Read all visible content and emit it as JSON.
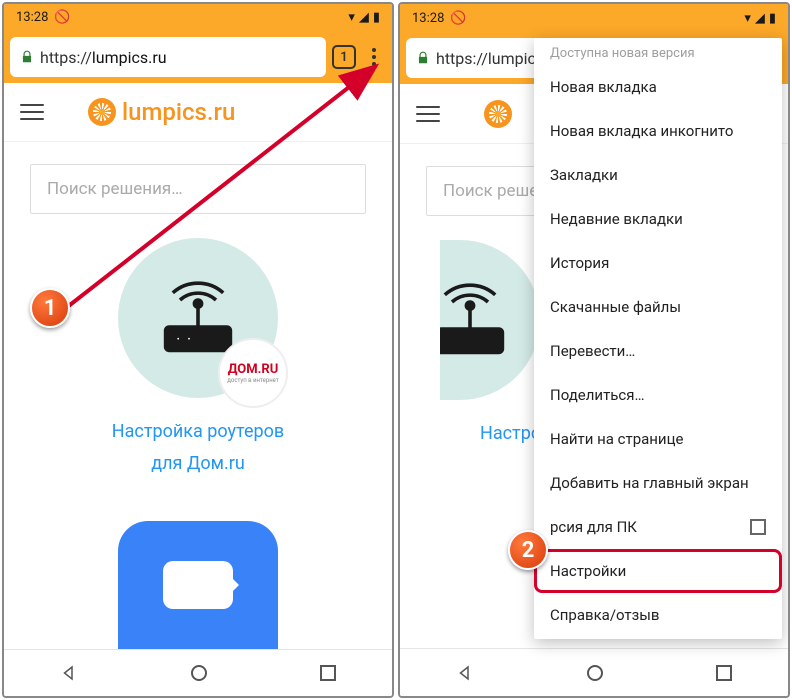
{
  "status": {
    "time": "13:28"
  },
  "url": {
    "scheme": "https://",
    "domain": "lumpics.ru",
    "clipped": "https://lumpics…"
  },
  "tabs": {
    "count": "1"
  },
  "site": {
    "logo_text": "lumpics.ru"
  },
  "search": {
    "placeholder": "Поиск решения…",
    "placeholder_clip": "Поиск решен"
  },
  "tile": {
    "line1": "Настройка роутеров",
    "line2": "для Дом.ru",
    "line1_clip": "Настро",
    "domru_brand": "ДОМ.RU",
    "domru_sub": "доступ в интернет"
  },
  "menu": {
    "header": "Доступна новая версия",
    "items": [
      "Новая вкладка",
      "Новая вкладка инкогнито",
      "Закладки",
      "Недавние вкладки",
      "История",
      "Скачанные файлы",
      "Перевести…",
      "Поделиться…",
      "Найти на странице",
      "Добавить на главный экран",
      "Версия для ПК",
      "Настройки",
      "Справка/отзыв"
    ],
    "desktop_partial": "рсия для ПК"
  },
  "badges": {
    "one": "1",
    "two": "2"
  }
}
